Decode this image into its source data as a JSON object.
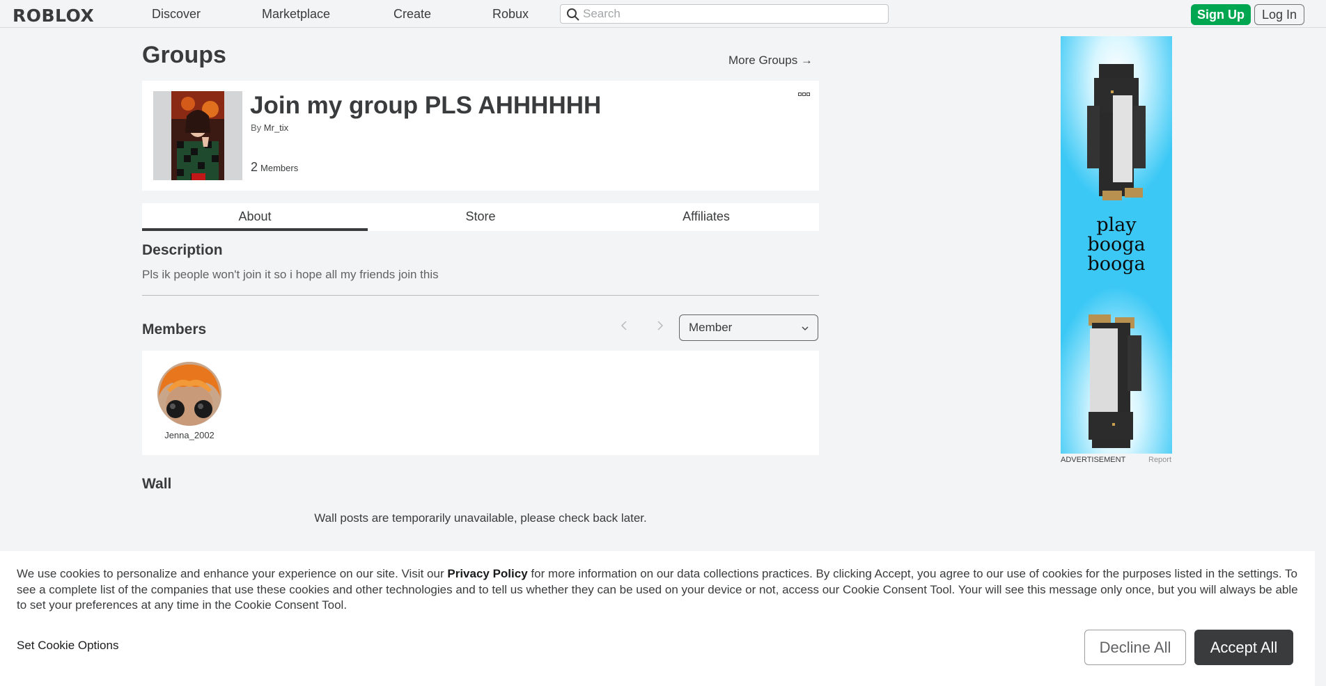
{
  "nav": {
    "logo": "ROBLOX",
    "links": [
      "Discover",
      "Marketplace",
      "Create",
      "Robux"
    ],
    "search_placeholder": "Search",
    "signup_label": "Sign Up",
    "login_label": "Log In"
  },
  "page": {
    "title": "Groups",
    "more_groups": "More Groups →"
  },
  "group": {
    "name": "Join my group PLS AHHHHHH",
    "by_label": "By",
    "owner": "Mr_tix",
    "member_count": "2",
    "members_label": "Members"
  },
  "tabs": [
    "About",
    "Store",
    "Affiliates"
  ],
  "description": {
    "title": "Description",
    "text": "Pls ik people won't join it so i hope all my friends join this"
  },
  "members": {
    "title": "Members",
    "role_selected": "Member",
    "list": [
      {
        "name": "Jenna_2002"
      }
    ]
  },
  "wall": {
    "title": "Wall",
    "message": "Wall posts are temporarily unavailable, please check back later."
  },
  "ad": {
    "text_lines": [
      "play",
      "booga",
      "booga"
    ],
    "label": "ADVERTISEMENT",
    "report": "Report"
  },
  "cookie": {
    "text_before": "We use cookies to personalize and enhance your experience on our site. Visit our ",
    "privacy_link": "Privacy Policy",
    "text_after": " for more information on our data collections practices. By clicking Accept, you agree to our use of cookies for the purposes listed in the settings. To see a complete list of the companies that use these cookies and other technologies and to tell us whether they can be used on your device or not, access our Cookie Consent Tool. Your will see this message only once, but you will always be able to set your preferences at any time in the Cookie Consent Tool.",
    "set_options": "Set Cookie Options",
    "decline": "Decline All",
    "accept": "Accept All"
  },
  "colors": {
    "signup_green": "#00a650",
    "background": "#f2f4f5",
    "accept_dark": "#393b3d",
    "ad_sky": "#3bc8f5"
  }
}
